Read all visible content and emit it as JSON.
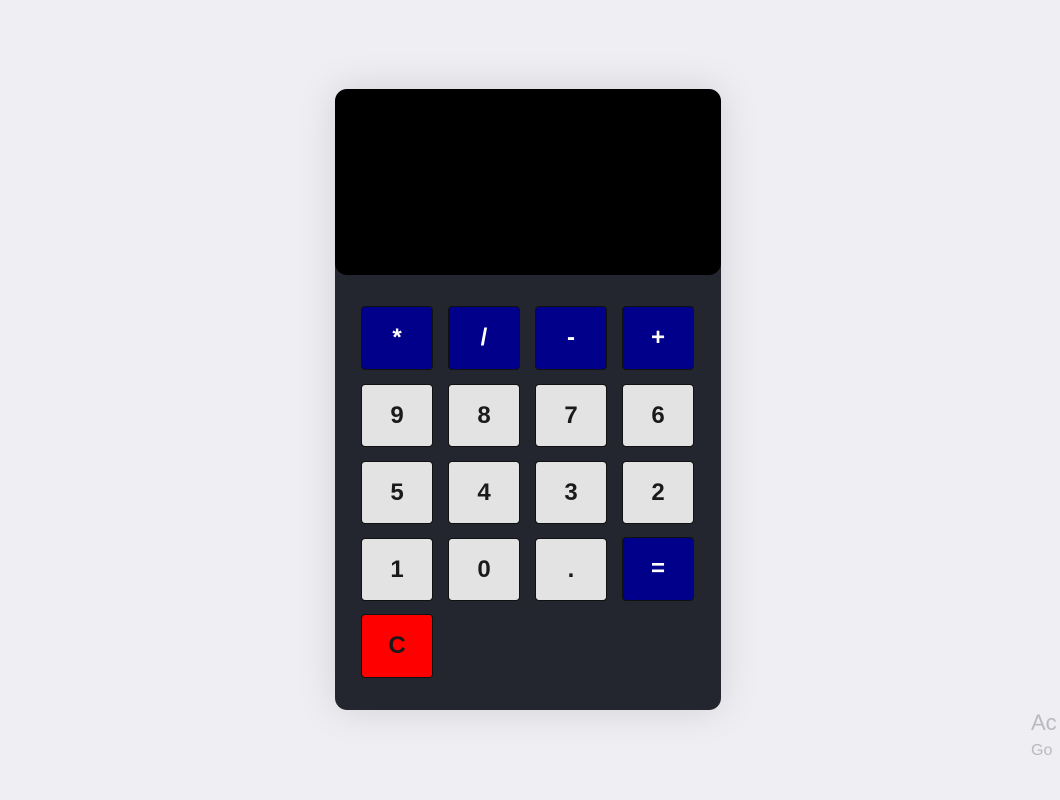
{
  "display": {
    "value": ""
  },
  "operators": [
    "*",
    "/",
    "-",
    "+"
  ],
  "digits_row1": [
    "9",
    "8",
    "7",
    "6"
  ],
  "digits_row2": [
    "5",
    "4",
    "3",
    "2"
  ],
  "digits_row3": [
    "1",
    "0",
    "."
  ],
  "equals": "=",
  "clear": "C",
  "watermark": {
    "line1": "Ac",
    "line2": "Go"
  },
  "colors": {
    "page_background": "#efeff3",
    "body": "#23262f",
    "display": "#000000",
    "operator_key": "#00008b",
    "number_key": "#e3e3e3",
    "clear_key": "#ff0000"
  }
}
